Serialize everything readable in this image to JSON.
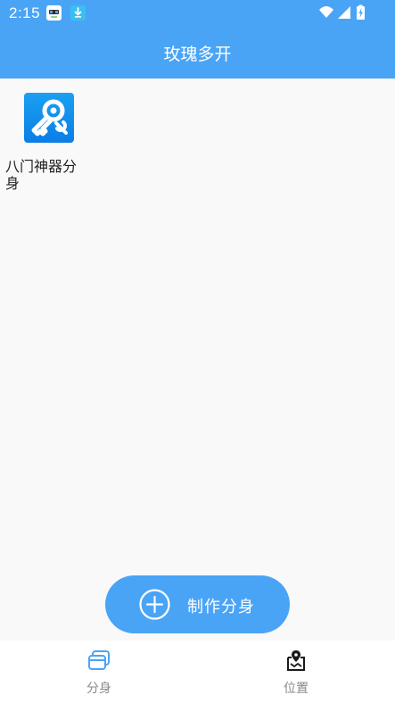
{
  "status_bar": {
    "time": "2:15",
    "notification_icons": [
      "clipboard-app-icon",
      "download-icon"
    ],
    "system_icons": [
      "wifi-icon",
      "cellular-signal-icon",
      "battery-charging-icon"
    ]
  },
  "app_bar": {
    "title": "玫瑰多开"
  },
  "clones": [
    {
      "label": "八门神器分身",
      "icon": "key-wrench-icon"
    }
  ],
  "fab": {
    "label": "制作分身",
    "icon": "plus-circle-icon"
  },
  "bottom_nav": {
    "tabs": [
      {
        "label": "分身",
        "icon": "clones-stack-icon",
        "selected": true
      },
      {
        "label": "位置",
        "icon": "location-map-icon",
        "selected": false
      }
    ]
  },
  "colors": {
    "primary": "#4aa4f6",
    "background": "#f9f9f9",
    "nav_active": "#4aa4f6",
    "nav_inactive": "#1a1a1a",
    "nav_label": "#8a8a8a"
  }
}
